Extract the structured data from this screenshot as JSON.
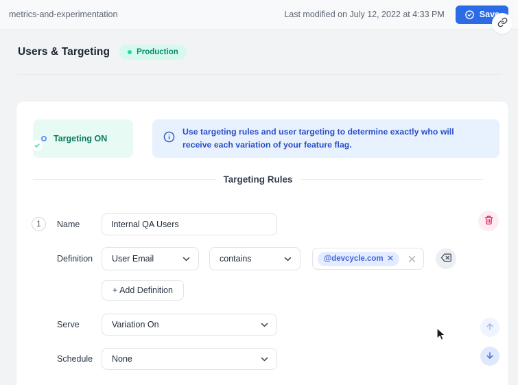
{
  "topbar": {
    "breadcrumb": "metrics-and-experimentation",
    "last_modified": "Last modified on July 12, 2022 at 4:33 PM",
    "save_label": "Save"
  },
  "header": {
    "title": "Users & Targeting",
    "environment_badge": "Production"
  },
  "targeting": {
    "toggle_label": "Targeting ON",
    "info_text": "Use targeting rules and user targeting to determine exactly who will receive each variation of your feature flag.",
    "rules_heading": "Targeting Rules"
  },
  "rule": {
    "index": "1",
    "name_label": "Name",
    "name_value": "Internal QA Users",
    "definition_label": "Definition",
    "property_value": "User Email",
    "comparator_value": "contains",
    "tag_value": "@devcycle.com",
    "add_definition_label": "+ Add Definition",
    "serve_label": "Serve",
    "serve_value": "Variation On",
    "schedule_label": "Schedule",
    "schedule_value": "None"
  },
  "icons": {
    "save": "check-circle-icon",
    "header_action": "link-icon",
    "info": "info-circle-icon",
    "delete_rule": "trash-icon",
    "clear_tags": "backspace-icon",
    "move_up": "arrow-up-icon",
    "move_down": "arrow-down-icon"
  },
  "colors": {
    "accent_blue": "#2b6ce6",
    "toggle_teal": "#33d6ab",
    "badge_bg": "#d5f9ec",
    "badge_text": "#0b8a6d",
    "info_bg": "#e8f1fe",
    "info_text": "#2b4fc7",
    "danger_pink": "#df2f6b",
    "tag_pill_bg": "#e4ecff",
    "tag_pill_text": "#3c64e2"
  }
}
